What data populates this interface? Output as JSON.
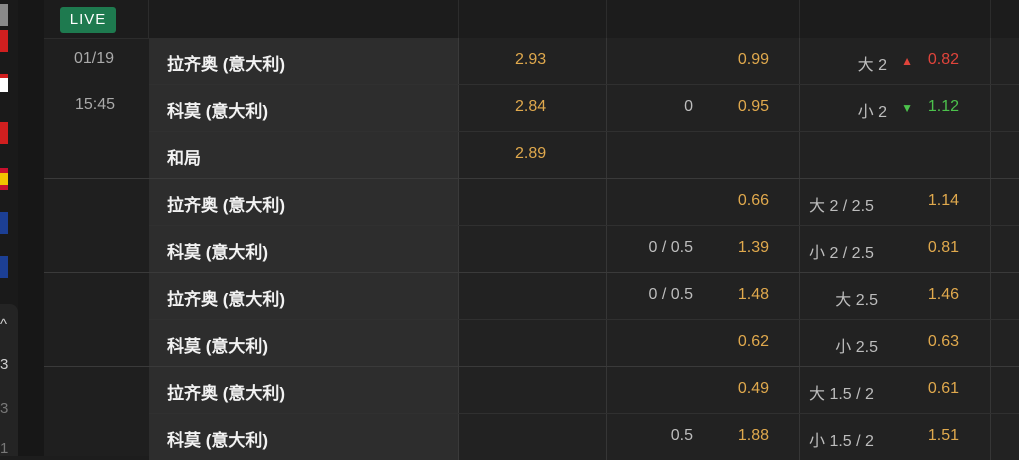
{
  "live_label": "LIVE",
  "match": {
    "date": "01/19",
    "time": "15:45"
  },
  "sidebar": {
    "text_items": [
      "^",
      "3",
      "3",
      "1"
    ]
  },
  "rows": [
    {
      "team": "拉齐奥 (意大利)",
      "odds_1x2": "2.93",
      "hdp_line": "",
      "hdp_odds": "0.99",
      "ou_line": "大 2",
      "ou_odds": "0.82",
      "ou_move": "up"
    },
    {
      "team": "科莫 (意大利)",
      "odds_1x2": "2.84",
      "hdp_line": "0",
      "hdp_odds": "0.95",
      "ou_line": "小 2",
      "ou_odds": "1.12",
      "ou_move": "down"
    },
    {
      "team": "和局",
      "odds_1x2": "2.89",
      "hdp_line": "",
      "hdp_odds": "",
      "ou_line": "",
      "ou_odds": ""
    },
    {
      "team": "拉齐奥 (意大利)",
      "odds_1x2": "",
      "hdp_line": "",
      "hdp_odds": "0.66",
      "ou_line": "大 2 / 2.5",
      "ou_odds": "1.14"
    },
    {
      "team": "科莫 (意大利)",
      "odds_1x2": "",
      "hdp_line": "0 / 0.5",
      "hdp_odds": "1.39",
      "ou_line": "小 2 / 2.5",
      "ou_odds": "0.81"
    },
    {
      "team": "拉齐奥 (意大利)",
      "odds_1x2": "",
      "hdp_line": "0 / 0.5",
      "hdp_odds": "1.48",
      "ou_line": "大 2.5",
      "ou_odds": "1.46"
    },
    {
      "team": "科莫 (意大利)",
      "odds_1x2": "",
      "hdp_line": "",
      "hdp_odds": "0.62",
      "ou_line": "小 2.5",
      "ou_odds": "0.63"
    },
    {
      "team": "拉齐奥 (意大利)",
      "odds_1x2": "",
      "hdp_line": "",
      "hdp_odds": "0.49",
      "ou_line": "大 1.5 / 2",
      "ou_odds": "0.61"
    },
    {
      "team": "科莫 (意大利)",
      "odds_1x2": "",
      "hdp_line": "0.5",
      "hdp_odds": "1.88",
      "ou_line": "小 1.5 / 2",
      "ou_odds": "1.51"
    }
  ],
  "colors": {
    "odds": "#e0a94d",
    "up": "#e0443b",
    "down": "#4cc24c",
    "live_badge": "#1e7a4f"
  }
}
